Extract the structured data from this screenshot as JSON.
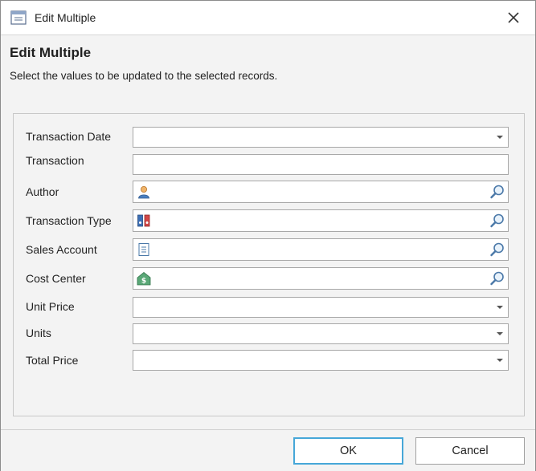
{
  "window": {
    "title": "Edit Multiple",
    "icon": "window-icon"
  },
  "header": {
    "title": "Edit Multiple",
    "subtitle": "Select the values to be updated to the selected records."
  },
  "form": {
    "fields": [
      {
        "label": "Transaction Date",
        "type": "dropdown",
        "value": ""
      },
      {
        "label": "Transaction",
        "type": "text",
        "value": ""
      },
      {
        "label": "Author",
        "type": "lookup",
        "icon": "person-icon",
        "value": ""
      },
      {
        "label": "Transaction Type",
        "type": "lookup",
        "icon": "binders-icon",
        "value": ""
      },
      {
        "label": "Sales Account",
        "type": "lookup",
        "icon": "document-icon",
        "value": ""
      },
      {
        "label": "Cost Center",
        "type": "lookup",
        "icon": "dollar-house-icon",
        "value": ""
      },
      {
        "label": "Unit Price",
        "type": "dropdown",
        "value": ""
      },
      {
        "label": "Units",
        "type": "dropdown",
        "value": ""
      },
      {
        "label": "Total Price",
        "type": "dropdown",
        "value": ""
      }
    ]
  },
  "buttons": {
    "ok": "OK",
    "cancel": "Cancel"
  },
  "colors": {
    "focus_border": "#46a7d8",
    "panel_bg": "#f3f3f3"
  }
}
